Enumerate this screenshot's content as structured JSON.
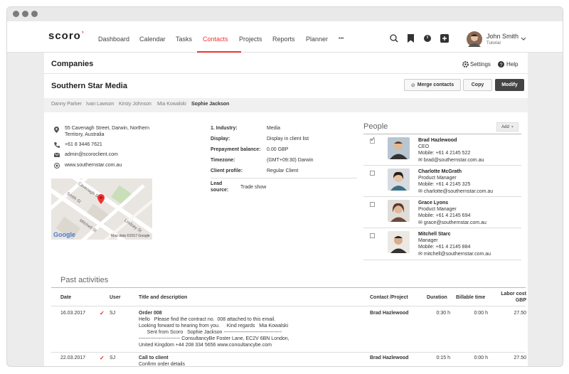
{
  "nav": {
    "logo": "scoro",
    "items": [
      "Dashboard",
      "Calendar",
      "Tasks",
      "Contacts",
      "Projects",
      "Reports",
      "Planner",
      "•••"
    ],
    "active": "Contacts",
    "user_name": "John Smith",
    "user_sub": "Tutorial",
    "accent": "#e33333"
  },
  "header": {
    "title": "Companies",
    "settings": "Settings",
    "help": "Help",
    "company": "Southern Star Media",
    "merge": "Merge contacts",
    "copy": "Copy",
    "modify": "Modify"
  },
  "tabs": [
    "Danny Parker",
    "Ivan Lawson",
    "Kirsty Johnson",
    "Mia Kowalski",
    "Sophie Jackson"
  ],
  "contact": {
    "address1": "55 Cavenagh Street, Darwin, Northern",
    "address2": "Territory, Australia",
    "phone": "+61 8 3446 7621",
    "email": "admin@scoroclient.com",
    "web": "www.southernstar.com.au",
    "map_google": "Google",
    "map_data": "Map data ©2017 Google",
    "streets": [
      "Cavenagh St",
      "Smith St",
      "Mitchell St",
      "Lindsay St"
    ]
  },
  "details": {
    "industry_label": "1. Industry:",
    "industry": "Media",
    "display_label": "Display:",
    "display": "Display in client list",
    "balance_label": "Prepayment balance:",
    "balance": "0.00 GBP",
    "tz_label": "Timezone:",
    "tz": "(GMT+09:30) Darwin",
    "profile_label": "Client profile:",
    "profile": "Regular Client",
    "lead_label1": "Lead",
    "lead_label2": "source:",
    "lead": "Trade show"
  },
  "people": {
    "title": "People",
    "add": "Add",
    "list": [
      {
        "name": "Brad Hazlewood",
        "role": "CEO",
        "mobile": "Mobile: +61 4 2145 522",
        "email": "brad@southernstar.com.au",
        "checked": true
      },
      {
        "name": "Charlotte McGrath",
        "role": "Product Manager",
        "mobile": "Mobile: +61 4 2145 325",
        "email": "charlotte@southernstar.com.au",
        "checked": false
      },
      {
        "name": "Grace Lyons",
        "role": "Product Manager",
        "mobile": "Mobile: +61 4 2145 694",
        "email": "grace@southernstar.com.au",
        "checked": false
      },
      {
        "name": "Mitchell Starc",
        "role": "Manager",
        "mobile": "Mobile: +61 4 2145 884",
        "email": "mitchell@southernstar.com.au",
        "checked": false
      }
    ]
  },
  "activities": {
    "title": "Past activities",
    "headers": {
      "date": "Date",
      "user": "User",
      "title": "Title and description",
      "contact": "Contact /Project",
      "duration": "Duration",
      "billable": "Billable time",
      "labor1": "Labor cost",
      "labor2": "GBP"
    },
    "rows": [
      {
        "date": "16.03.2017",
        "user": "SJ",
        "title": "Order 008",
        "desc": [
          "Hello   Please find the contract no.  008 attached to this email.",
          "Looking forward to hearing from you.     Kind regards   Mia Kowalski",
          "      Sent from Scoro   Sophie Jackson -----------------------------------",
          "------------------------- ConsultancyBe Foster Lane, EC2V 6BN London,",
          "United Kingdom +44 208 334 5656 www.consultancybe.com"
        ],
        "contact": "Brad Hazlewood",
        "duration": "0:30 h",
        "billable": "0:00 h",
        "labor": "27.50"
      },
      {
        "date": "22.03.2017",
        "user": "SJ",
        "title": "Call to client",
        "desc": [
          "Confirm order details"
        ],
        "contact": "Brad Hazlewood",
        "duration": "0:15 h",
        "billable": "0:00 h",
        "labor": "27.50"
      }
    ]
  }
}
